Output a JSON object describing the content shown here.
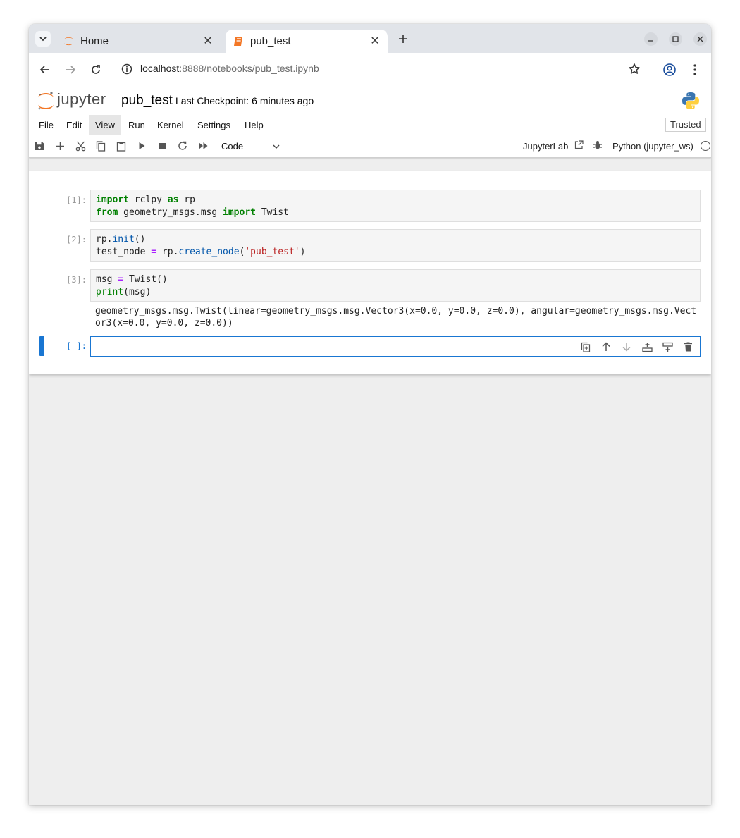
{
  "browser": {
    "tabs": [
      {
        "title": "Home",
        "icon": "jupyter-icon",
        "active": false
      },
      {
        "title": "pub_test",
        "icon": "notebook-icon",
        "active": true
      }
    ],
    "url_host": "localhost",
    "url_rest": ":8888/notebooks/pub_test.ipynb"
  },
  "header": {
    "logo_text": "jupyter",
    "notebook_title": "pub_test",
    "checkpoint": "Last Checkpoint: 6 minutes ago"
  },
  "menu": {
    "items": [
      "File",
      "Edit",
      "View",
      "Run",
      "Kernel",
      "Settings",
      "Help"
    ],
    "highlighted": "View",
    "trusted_label": "Trusted"
  },
  "toolbar": {
    "cell_type": "Code",
    "jupyterlab_label": "JupyterLab",
    "kernel_name": "Python (jupyter_ws)"
  },
  "cells": [
    {
      "prompt": "[1]:",
      "code": [
        "import rclpy as rp",
        "from geometry_msgs.msg import Twist"
      ]
    },
    {
      "prompt": "[2]:",
      "code": [
        "rp.init()",
        "test_node = rp.create_node('pub_test')"
      ]
    },
    {
      "prompt": "[3]:",
      "code": [
        "msg = Twist()",
        "print(msg)"
      ],
      "output": [
        "geometry_msgs.msg.Twist(linear=geometry_msgs.msg.Vector3(x=0.0, y=0.0, z=0.0), angular=geometry_msgs.msg.Vect",
        "or3(x=0.0, y=0.0, z=0.0))"
      ]
    },
    {
      "prompt": "[ ]:",
      "code": []
    }
  ],
  "colors": {
    "active_cell": "#1976d2",
    "keyword": "#008000",
    "operator": "#aa22ff",
    "string": "#ba2121",
    "jupyter_orange": "#f37726"
  }
}
